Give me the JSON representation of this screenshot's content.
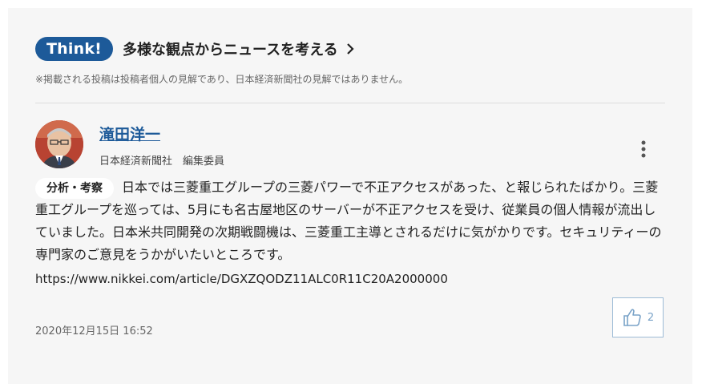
{
  "header": {
    "badge": "Think!",
    "title": "多様な観点からニュースを考える",
    "disclaimer": "※掲載される投稿は投稿者個人の見解であり、日本経済新聞社の見解ではありません。"
  },
  "author": {
    "name": "滝田洋一",
    "affiliation": "日本経済新聞社　編集委員"
  },
  "post": {
    "tag": "分析・考察",
    "text": "日本では三菱重工グループの三菱パワーで不正アクセスがあった、と報じられたばかり。三菱重工グループを巡っては、5月にも名古屋地区のサーバーが不正アクセスを受け、従業員の個人情報が流出していました。日本米共同開発の次期戦闘機は、三菱重工主導とされるだけに気がかりです。セキュリティーの専門家のご意見をうかがいたいところです。",
    "url": "https://www.nikkei.com/article/DGXZQODZ11ALC0R11C20A2000000",
    "timestamp": "2020年12月15日 16:52",
    "likes": "2"
  },
  "icons": {
    "chevron": "chevron-right-icon",
    "more": "more-vertical-icon",
    "like": "thumbs-up-icon"
  },
  "colors": {
    "brand": "#1d5a99",
    "like_border": "#9dbbd6"
  }
}
